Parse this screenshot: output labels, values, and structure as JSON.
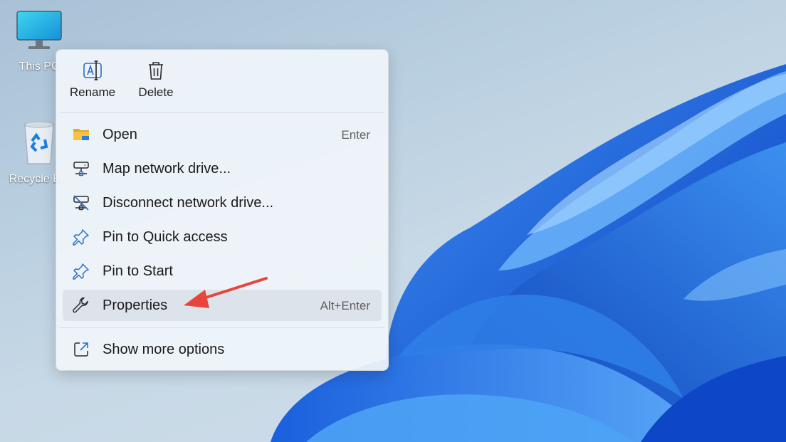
{
  "desktop": {
    "icons": [
      {
        "label": "This PC",
        "icon": "monitor-icon"
      },
      {
        "label": "Recycle Bin",
        "icon": "recycle-bin-icon"
      }
    ]
  },
  "context_menu": {
    "quick_actions": [
      {
        "label": "Rename",
        "icon": "rename-icon"
      },
      {
        "label": "Delete",
        "icon": "trash-icon"
      }
    ],
    "items": [
      {
        "label": "Open",
        "shortcut": "Enter",
        "icon": "folder-icon"
      },
      {
        "label": "Map network drive...",
        "shortcut": "",
        "icon": "network-drive-icon"
      },
      {
        "label": "Disconnect network drive...",
        "shortcut": "",
        "icon": "disconnect-drive-icon"
      },
      {
        "label": "Pin to Quick access",
        "shortcut": "",
        "icon": "pin-icon"
      },
      {
        "label": "Pin to Start",
        "shortcut": "",
        "icon": "pin-icon"
      },
      {
        "label": "Properties",
        "shortcut": "Alt+Enter",
        "icon": "wrench-icon",
        "highlighted": true
      },
      {
        "label": "Show more options",
        "shortcut": "",
        "icon": "external-open-icon"
      }
    ]
  },
  "colors": {
    "accent_blue": "#1a6fd8",
    "arrow_red": "#e8453c",
    "folder_yellow": "#f5c242"
  }
}
